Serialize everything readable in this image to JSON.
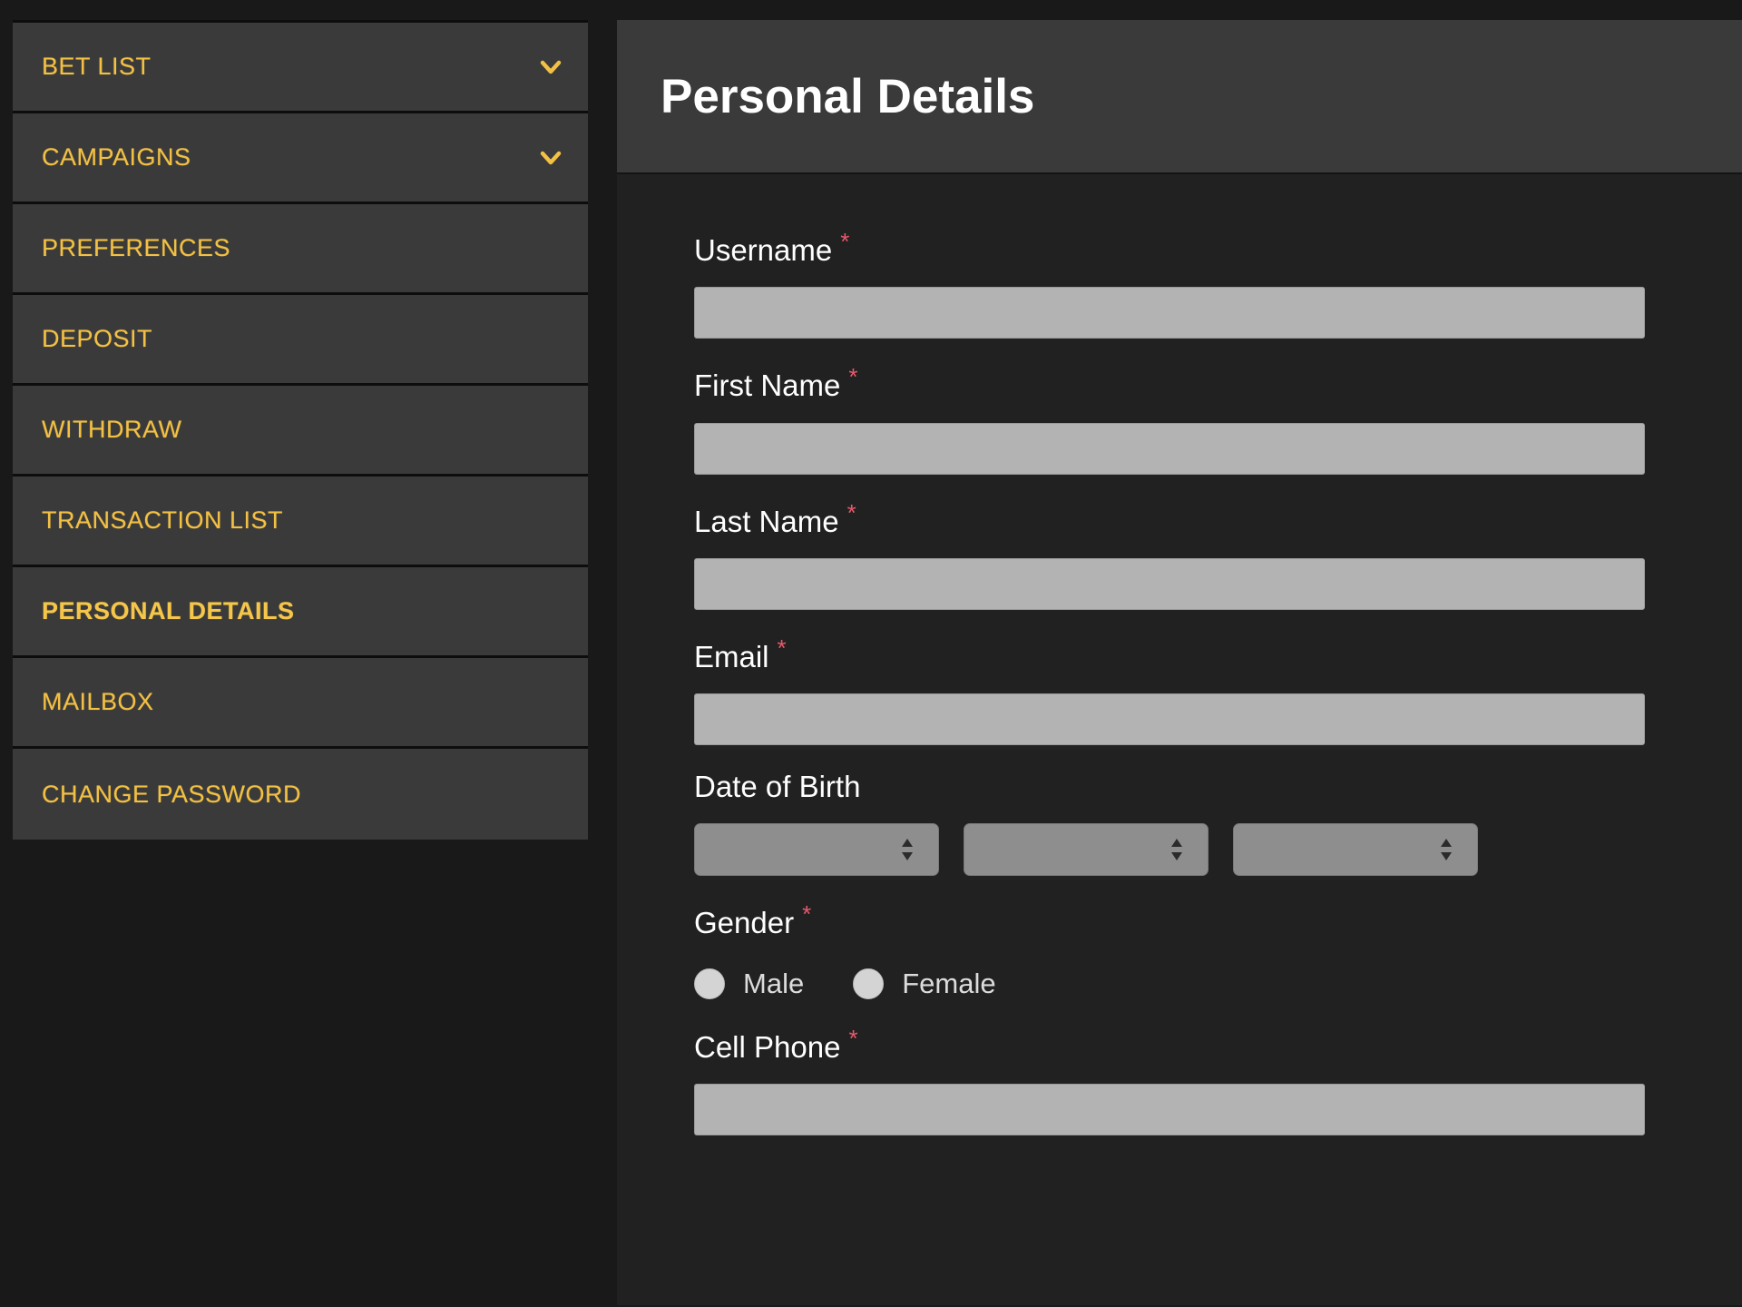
{
  "sidebar": {
    "items": [
      {
        "label": "BET LIST",
        "icon": "chevron-down-icon",
        "has_chevron": true,
        "active": false
      },
      {
        "label": "CAMPAIGNS",
        "icon": "chevron-down-icon",
        "has_chevron": true,
        "active": false
      },
      {
        "label": "PREFERENCES",
        "has_chevron": false,
        "active": false
      },
      {
        "label": "DEPOSIT",
        "has_chevron": false,
        "active": false
      },
      {
        "label": "WITHDRAW",
        "has_chevron": false,
        "active": false
      },
      {
        "label": "TRANSACTION LIST",
        "has_chevron": false,
        "active": false
      },
      {
        "label": "PERSONAL DETAILS",
        "has_chevron": false,
        "active": true
      },
      {
        "label": "MAILBOX",
        "has_chevron": false,
        "active": false
      },
      {
        "label": "CHANGE PASSWORD",
        "has_chevron": false,
        "active": false
      }
    ]
  },
  "header": {
    "title": "Personal Details"
  },
  "form": {
    "required_marker": "*",
    "fields": {
      "username": {
        "label": "Username",
        "value": "",
        "placeholder": ""
      },
      "first_name": {
        "label": "First Name",
        "value": "",
        "placeholder": ""
      },
      "last_name": {
        "label": "Last Name",
        "value": "",
        "placeholder": ""
      },
      "email": {
        "label": "Email",
        "value": "",
        "placeholder": ""
      },
      "date_of_birth": {
        "label": "Date of Birth",
        "selects": [
          {
            "name": "day",
            "value": ""
          },
          {
            "name": "month",
            "value": ""
          },
          {
            "name": "year",
            "value": ""
          }
        ]
      },
      "gender": {
        "label": "Gender",
        "options": [
          {
            "label": "Male",
            "selected": false
          },
          {
            "label": "Female",
            "selected": false
          }
        ]
      },
      "cell_phone": {
        "label": "Cell Phone",
        "value": "",
        "placeholder": ""
      }
    }
  },
  "colors": {
    "accent_yellow": "#f2c044",
    "required_red": "#e8596b",
    "sidebar_item_bg": "#3a3a3a",
    "page_bg": "#191919",
    "panel_bg": "#212121",
    "input_bg": "#b3b3b3",
    "select_bg": "#8e8e8e"
  }
}
